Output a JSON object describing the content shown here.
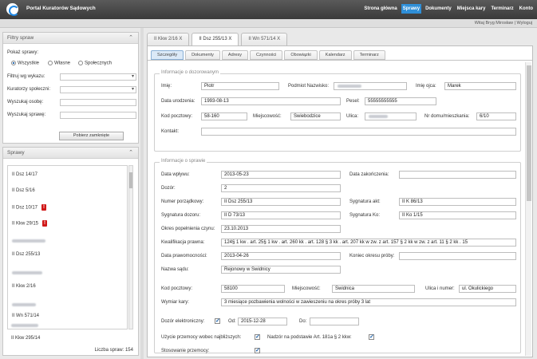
{
  "header": {
    "title": "Portal Kuratorów Sądowych",
    "nav": [
      {
        "label": "Strona główna",
        "active": false
      },
      {
        "label": "Sprawy",
        "active": true
      },
      {
        "label": "Dokumenty",
        "active": false
      },
      {
        "label": "Miejsca kary",
        "active": false
      },
      {
        "label": "Terminarz",
        "active": false
      },
      {
        "label": "Konto",
        "active": false
      }
    ],
    "user_line": "Witaj Bryg Mirosław | Wyloguj"
  },
  "filters": {
    "title": "Filtry spraw",
    "show_label": "Pokaż sprawy:",
    "radios": [
      {
        "label": "Wszystkie",
        "checked": true
      },
      {
        "label": "Własne",
        "checked": false
      },
      {
        "label": "Społecznych",
        "checked": false
      }
    ],
    "fields": [
      {
        "label": "Filtruj wg wykazu:",
        "kind": "select"
      },
      {
        "label": "Kuratorzy społeczni:",
        "kind": "select"
      },
      {
        "label": "Wyszukaj osobę:",
        "kind": "input"
      },
      {
        "label": "Wyszukaj sprawę:",
        "kind": "input"
      }
    ],
    "closed_button": "Pobierz zamknięte"
  },
  "cases": {
    "title": "Sprawy",
    "items": [
      {
        "label": "II Dsz 14/17",
        "flag": false
      },
      {
        "label": "II Dsz 5/16",
        "flag": false
      },
      {
        "label": "II Dsz 10/17",
        "flag": true
      },
      {
        "label": "II Kkw 29/15",
        "flag": true
      },
      {
        "label": "",
        "flag": false
      },
      {
        "label": "II Dsz 255/13",
        "flag": false
      },
      {
        "label": "",
        "flag": false
      },
      {
        "label": "II Kkw 2/16",
        "flag": false
      },
      {
        "label": "",
        "flag": false
      },
      {
        "label": "II Wn 571/14",
        "flag": false
      },
      {
        "label": "",
        "flag": false
      },
      {
        "label": "II Kkw 295/14",
        "flag": false
      },
      {
        "label": "",
        "flag": false
      },
      {
        "label": "II Dsz 7/16",
        "flag": false
      }
    ],
    "count_label": "Liczba spraw: 154",
    "flag_symbol": "!"
  },
  "case_tabs": [
    {
      "label": "II Kkw 2/16",
      "active": false
    },
    {
      "label": "II Dsz 255/13",
      "active": true
    },
    {
      "label": "II Wn 571/14",
      "active": false
    }
  ],
  "close_symbol": "X",
  "sub_tabs": [
    {
      "label": "Szczegóły",
      "active": true
    },
    {
      "label": "Dokumenty",
      "active": false
    },
    {
      "label": "Adresy",
      "active": false
    },
    {
      "label": "Czynności",
      "active": false
    },
    {
      "label": "Obowiązki",
      "active": false
    },
    {
      "label": "Kalendarz",
      "active": false
    },
    {
      "label": "Terminarz",
      "active": false
    }
  ],
  "person": {
    "legend": "Informacje o dozorowanym",
    "first_name_label": "Imię:",
    "first_name": "Piotr",
    "taxpayer_label": "Podmiot Nazwisko:",
    "taxpayer": "",
    "father_label": "Imię ojca:",
    "father": "Marek",
    "dob_label": "Data urodzenia:",
    "dob": "1993-08-13",
    "pesel_label": "Pesel:",
    "pesel": "55555555555",
    "zip_label": "Kod pocztowy:",
    "zip": "58-160",
    "city_label": "Miejscowość:",
    "city": "Świebodzice",
    "street_label": "Ulica:",
    "street": "",
    "house_label": "Nr domu/mieszkania:",
    "house": "6/10",
    "contact_label": "Kontakt:",
    "contact": ""
  },
  "case": {
    "legend": "Informacje o sprawie",
    "received_label": "Data wpływu:",
    "received": "2013-05-23",
    "closed_label": "Data zakończenia:",
    "closed": "",
    "supervision_label": "Dozór:",
    "supervision": "2",
    "number_label": "Numer porządkowy:",
    "number": "II Dsz 255/13",
    "file_sig_label": "Sygnatura akt:",
    "file_sig": "II K 86/13",
    "sup_sig_label": "Sygnatura dozoru:",
    "sup_sig": "II D 73/13",
    "ko_sig_label": "Sygnatura Ko:",
    "ko_sig": "II Ko 1/15",
    "crime_period_label": "Okres popełnienia czynu:",
    "crime_period": "23.10.2013",
    "qualification_label": "Kwalifikacja prawna:",
    "qualification": "124§ 1 kw . art. 25§ 1 kw . art. 260 kk . art. 128 § 3 kk . art. 207 kk w zw. z art. 157 § 2 kk w zw. z art. 11 § 2 kk . 15",
    "valid_date_label": "Data prawomocności:",
    "valid_date": "2013-04-26",
    "probation_end_label": "Koniec okresu próby:",
    "probation_end": "",
    "court_label": "Nazwa sądu:",
    "court": "Rejonowy w Świdnicy",
    "court_zip_label": "Kod pocztowy:",
    "court_zip": "58100",
    "court_city_label": "Miejscowość:",
    "court_city": "Świdnica",
    "court_street_label": "Ulica i numer:",
    "court_street": "ul. Okulickiego",
    "sentence_label": "Wymiar kary:",
    "sentence": "3 miesiące pozbawienia wolności w zawieszeniu na okres próby 3 lat",
    "e_supervision_label": "Dozór elektroniczny:",
    "e_supervision": true,
    "from_label": "Od:",
    "from": "2015-12-28",
    "to_label": "Do:",
    "to": "",
    "violence_label": "Użycie przemocy wobec najbliższych:",
    "violence": true,
    "art_label": "Nadzór na podstawie Art. 181a § 2 kkw:",
    "art": true,
    "violence_use_label": "Stosowanie przemocy:",
    "violence_use": true,
    "check_symbol": "✓"
  }
}
